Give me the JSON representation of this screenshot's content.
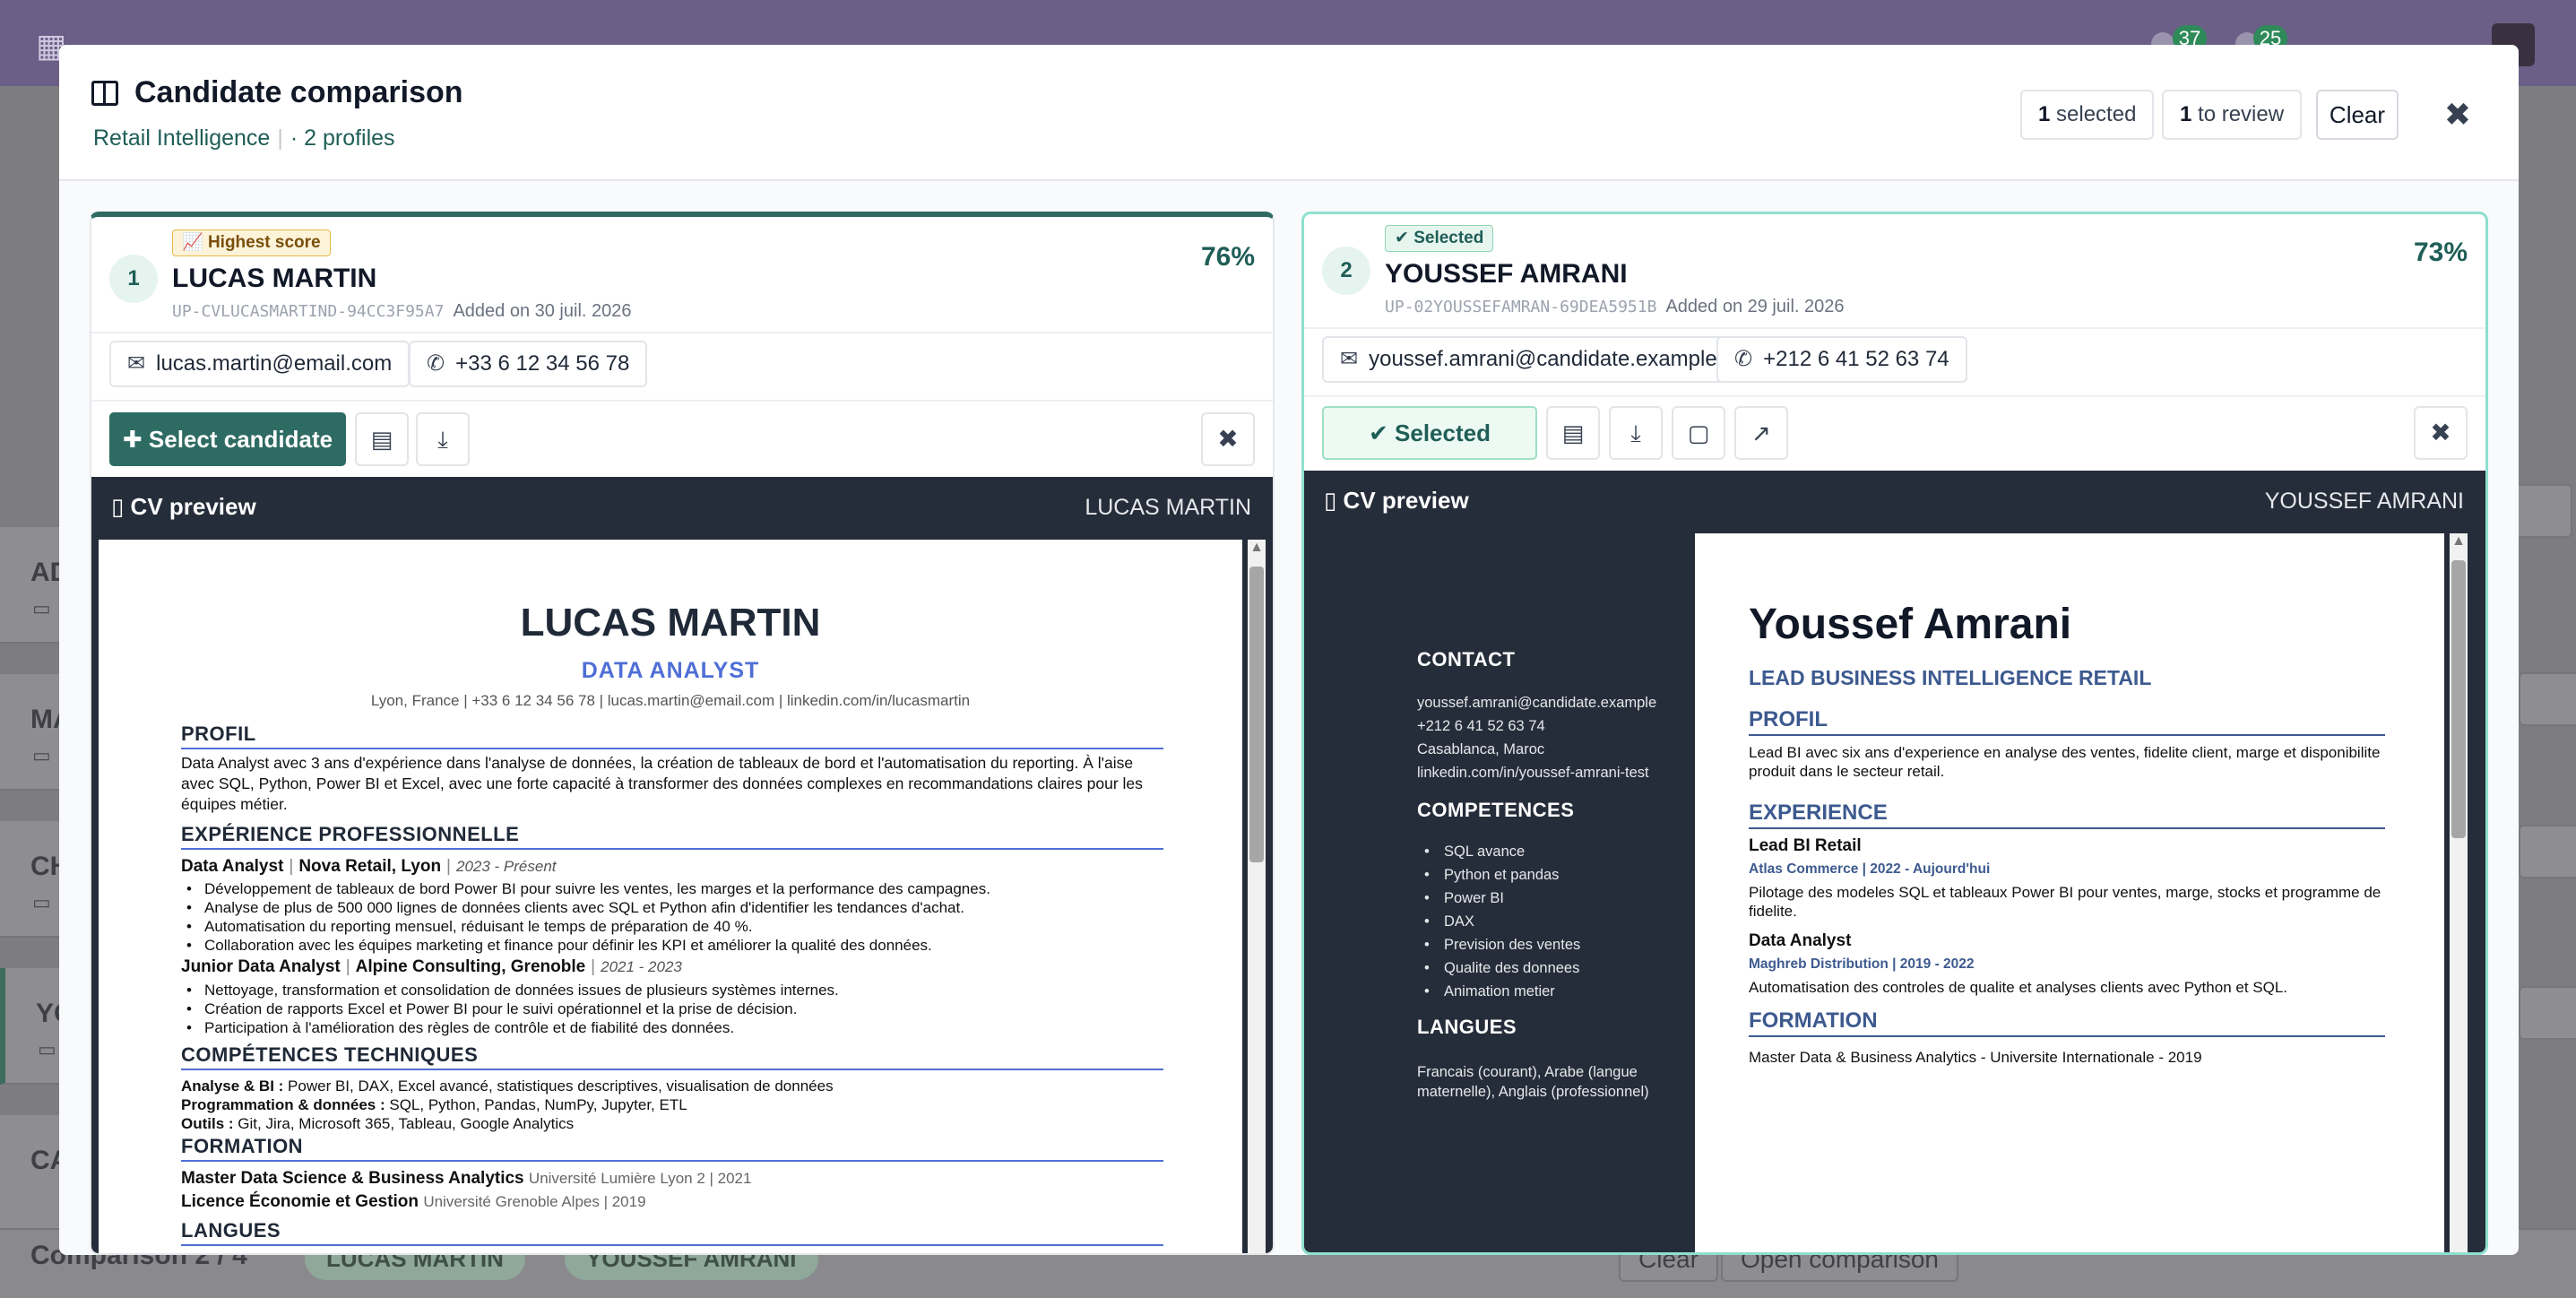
{
  "background": {
    "cards": [
      "AD",
      "MA",
      "CH",
      "YO",
      "CA"
    ],
    "nav_badges": [
      "37",
      "25"
    ],
    "bottom_bar": {
      "label": "Comparison",
      "count": "2 / 4",
      "chips": [
        "LUCAS MARTIN",
        "YOUSSEF AMRANI"
      ],
      "clear": "Clear",
      "open": "Open comparison"
    }
  },
  "modal": {
    "title": "Candidate comparison",
    "organization": "Retail Intelligence",
    "profiles": "· 2 profiles",
    "selected_count": "1",
    "selected_label": "selected",
    "review_count": "1",
    "review_label": "to review",
    "clear_label": "Clear",
    "close_glyph": "✖"
  },
  "candidates": [
    {
      "rank": "1",
      "tag": "Highest score",
      "name": "LUCAS MARTIN",
      "reference": "UP-CVLUCASMARTIND-94CC3F95A7",
      "added": "Added on 30 juil. 2026",
      "score": "76%",
      "email": "lucas.martin@email.com",
      "phone": "+33 6 12 34 56 78",
      "select_label": "Select candidate",
      "cv_preview_label": "CV preview",
      "cv_preview_name": "LUCAS MARTIN",
      "cv": {
        "name": "LUCAS MARTIN",
        "role": "DATA ANALYST",
        "contact": "Lyon, France  |  +33 6 12 34 56 78  |  lucas.martin@email.com  |  linkedin.com/in/lucasmartin",
        "profile_heading": "PROFIL",
        "profile": "Data Analyst avec 3 ans d'expérience dans l'analyse de données, la création de tableaux de bord et l'automatisation du reporting. À l'aise avec SQL, Python, Power BI et Excel, avec une forte capacité à transformer des données complexes en recommandations claires pour les équipes métier.",
        "experience_heading": "EXPÉRIENCE PROFESSIONNELLE",
        "job1_title": "Data Analyst",
        "job1_company": "Nova Retail, Lyon",
        "job1_dates": "2023 - Présent",
        "job1_bullets": [
          "Développement de tableaux de bord Power BI pour suivre les ventes, les marges et la performance des campagnes.",
          "Analyse de plus de 500 000 lignes de données clients avec SQL et Python afin d'identifier les tendances d'achat.",
          "Automatisation du reporting mensuel, réduisant le temps de préparation de 40 %.",
          "Collaboration avec les équipes marketing et finance pour définir les KPI et améliorer la qualité des données."
        ],
        "job2_title": "Junior Data Analyst",
        "job2_company": "Alpine Consulting, Grenoble",
        "job2_dates": "2021 - 2023",
        "job2_bullets": [
          "Nettoyage, transformation et consolidation de données issues de plusieurs systèmes internes.",
          "Création de rapports Excel et Power BI pour le suivi opérationnel et la prise de décision.",
          "Participation à l'amélioration des règles de contrôle et de fiabilité des données."
        ],
        "skills_heading": "COMPÉTENCES TECHNIQUES",
        "skill1_label": "Analyse & BI :",
        "skill1_value": "Power BI, DAX, Excel avancé, statistiques descriptives, visualisation de données",
        "skill2_label": "Programmation & données :",
        "skill2_value": "SQL, Python, Pandas, NumPy, Jupyter, ETL",
        "skill3_label": "Outils :",
        "skill3_value": "Git, Jira, Microsoft 365, Tableau, Google Analytics",
        "education_heading": "FORMATION",
        "edu1_title": "Master Data Science & Business Analytics",
        "edu1_detail": "Université Lumière Lyon 2  |  2021",
        "edu2_title": "Licence Économie et Gestion",
        "edu2_detail": "Université Grenoble Alpes  |  2019",
        "next_heading": "LANGUES"
      }
    },
    {
      "rank": "2",
      "tag": "Selected",
      "name": "YOUSSEF AMRANI",
      "reference": "UP-02YOUSSEFAMRAN-69DEA5951B",
      "added": "Added on 29 juil. 2026",
      "score": "73%",
      "email": "youssef.amrani@candidate.example",
      "phone": "+212 6 41 52 63 74",
      "select_label": "Selected",
      "cv_preview_label": "CV preview",
      "cv_preview_name": "YOUSSEF AMRANI",
      "cv": {
        "contact_heading": "CONTACT",
        "contact_lines": [
          "youssef.amrani@candidate.example",
          "+212 6 41 52 63 74",
          "Casablanca, Maroc",
          "linkedin.com/in/youssef-amrani-test"
        ],
        "skills_heading": "COMPETENCES",
        "skills": [
          "SQL avance",
          "Python et pandas",
          "Power BI",
          "DAX",
          "Prevision des ventes",
          "Qualite des donnees",
          "Animation metier"
        ],
        "languages_heading": "LANGUES",
        "languages_1": "Francais (courant), Arabe (langue",
        "languages_2": "maternelle), Anglais (professionnel)",
        "name": "Youssef Amrani",
        "role": "LEAD BUSINESS INTELLIGENCE RETAIL",
        "profile_heading": "PROFIL",
        "profile": "Lead BI avec six ans d'experience en analyse des ventes, fidelite client, marge et disponibilite produit dans le secteur retail.",
        "experience_heading": "EXPERIENCE",
        "job1_title": "Lead BI Retail",
        "job1_company": "Atlas Commerce | 2022 - Aujourd'hui",
        "job1_desc": "Pilotage des modeles SQL et tableaux Power BI pour ventes, marge, stocks et programme de fidelite.",
        "job2_title": "Data Analyst",
        "job2_company": "Maghreb Distribution | 2019 - 2022",
        "job2_desc": "Automatisation des controles de qualite et analyses clients avec Python et SQL.",
        "education_heading": "FORMATION",
        "education": "Master Data & Business Analytics - Universite Internationale - 2019"
      }
    }
  ]
}
